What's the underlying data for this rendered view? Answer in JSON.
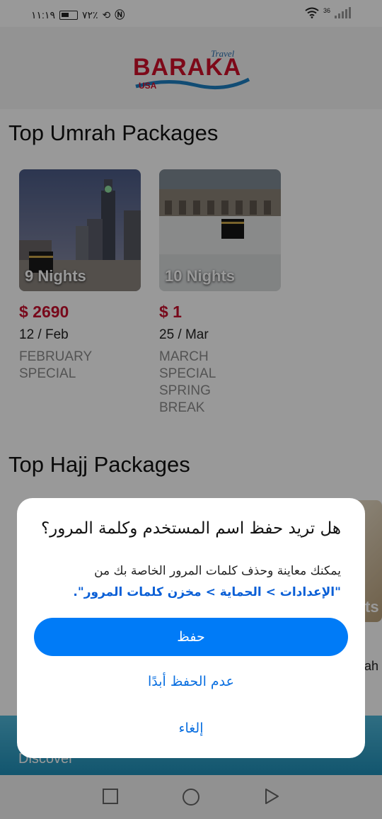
{
  "status_bar": {
    "time": "١١:١٩",
    "battery": "٧٢٪",
    "network": "36"
  },
  "header": {
    "logo_brand": "BARAKA",
    "logo_travel": "Travel",
    "logo_country": "USA"
  },
  "umrah": {
    "title": "Top Umrah Packages",
    "packages": [
      {
        "nights": "9 Nights",
        "price": "$ 2690",
        "date": "12 / Feb",
        "description": "FEBRUARY SPECIAL"
      },
      {
        "nights": "10 Nights",
        "price": "$ 1",
        "date": "25 / Mar",
        "description": "MARCH SPECIAL SPRING BREAK"
      }
    ]
  },
  "hajj": {
    "title": "Top Hajj Packages",
    "card_partial_text": "ts",
    "card_partial_caption": "tah"
  },
  "discover": {
    "label": "Discover"
  },
  "dialog": {
    "title": "هل تريد حفظ اسم المستخدم وكلمة المرور؟",
    "body_prefix": "يمكنك معاينة وحذف كلمات المرور الخاصة بك من",
    "body_link": "\"الإعدادات > الحماية > مخزن كلمات المرور\".",
    "save_label": "حفظ",
    "never_label": "عدم الحفظ أبدًا",
    "cancel_label": "إلغاء"
  }
}
